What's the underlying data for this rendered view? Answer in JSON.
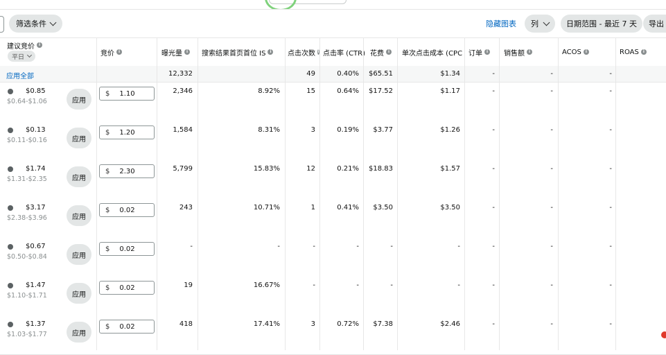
{
  "toolbar": {
    "filter_label": "筛选条件",
    "hide_chart_label": "隐藏图表",
    "columns_label": "列",
    "date_range_label": "日期范围 - 最近 7 天",
    "export_label": "导出"
  },
  "table": {
    "headers": {
      "suggested_bid": "建议竞价",
      "average_select": "平日",
      "bid": "竞价",
      "impressions": "曝光量",
      "top_of_search": "搜索结果首页首位 IS",
      "clicks": "点击次数",
      "ctr": "点击率 (CTR)",
      "spend": "花费",
      "cpc": "单次点击成本 (CPC)",
      "orders": "订单",
      "sales": "销售额",
      "acos": "ACOS",
      "roas": "ROAS"
    },
    "summary": {
      "apply_all": "应用全部",
      "impressions": "12,332",
      "clicks": "49",
      "ctr": "0.40%",
      "spend": "$65.51",
      "cpc": "$1.34",
      "orders": "-",
      "sales": "-",
      "acos": "-"
    },
    "apply_label": "应用",
    "currency_symbol": "$",
    "rows": [
      {
        "suggested": "$0.85",
        "range": "$0.64-$1.06",
        "bid": "1.10",
        "impressions": "2,346",
        "top_of_search": "8.92%",
        "clicks": "15",
        "ctr": "0.64%",
        "spend": "$17.52",
        "cpc": "$1.17",
        "orders": "-",
        "sales": "-",
        "acos": "-"
      },
      {
        "suggested": "$0.13",
        "range": "$0.11-$0.16",
        "bid": "1.20",
        "impressions": "1,584",
        "top_of_search": "8.31%",
        "clicks": "3",
        "ctr": "0.19%",
        "spend": "$3.77",
        "cpc": "$1.26",
        "orders": "-",
        "sales": "-",
        "acos": "-"
      },
      {
        "suggested": "$1.74",
        "range": "$1.31-$2.35",
        "bid": "2.30",
        "impressions": "5,799",
        "top_of_search": "15.83%",
        "clicks": "12",
        "ctr": "0.21%",
        "spend": "$18.83",
        "cpc": "$1.57",
        "orders": "-",
        "sales": "-",
        "acos": "-"
      },
      {
        "suggested": "$3.17",
        "range": "$2.38-$3.96",
        "bid": "0.02",
        "impressions": "243",
        "top_of_search": "10.71%",
        "clicks": "1",
        "ctr": "0.41%",
        "spend": "$3.50",
        "cpc": "$3.50",
        "orders": "-",
        "sales": "-",
        "acos": "-"
      },
      {
        "suggested": "$0.67",
        "range": "$0.50-$0.84",
        "bid": "0.02",
        "impressions": "-",
        "top_of_search": "-",
        "clicks": "-",
        "ctr": "-",
        "spend": "-",
        "cpc": "-",
        "orders": "-",
        "sales": "-",
        "acos": "-"
      },
      {
        "suggested": "$1.47",
        "range": "$1.10-$1.71",
        "bid": "0.02",
        "impressions": "19",
        "top_of_search": "16.67%",
        "clicks": "-",
        "ctr": "-",
        "spend": "-",
        "cpc": "-",
        "orders": "-",
        "sales": "-",
        "acos": "-"
      },
      {
        "suggested": "$1.37",
        "range": "$1.03-$1.77",
        "bid": "0.02",
        "impressions": "418",
        "top_of_search": "17.41%",
        "clicks": "3",
        "ctr": "0.72%",
        "spend": "$7.38",
        "cpc": "$2.46",
        "orders": "-",
        "sales": "-",
        "acos": "-"
      }
    ]
  },
  "colors": {
    "link_blue": "#0066c0",
    "button_gray": "#e3e6e6",
    "muted_text": "#8a8f90",
    "notification_red": "#e0392b"
  }
}
